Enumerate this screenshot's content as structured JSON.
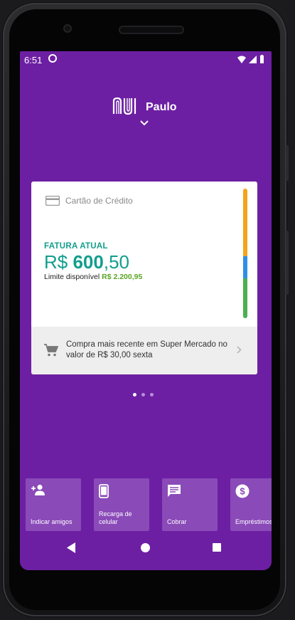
{
  "status_bar": {
    "time": "6:51"
  },
  "header": {
    "user_name": "Paulo"
  },
  "card": {
    "title": "Cartão de Crédito",
    "invoice_label": "FATURA ATUAL",
    "amount_currency": "R$ ",
    "amount_integer": "600",
    "amount_cents": ",50",
    "limit_label": "Limite disponível ",
    "limit_value": "R$ 2.200,95",
    "usage_bar": [
      {
        "color": "#f5a31a",
        "fraction": 0.52
      },
      {
        "color": "#2f8fe8",
        "fraction": 0.17
      },
      {
        "color": "#4caf50",
        "fraction": 0.31
      }
    ],
    "recent_purchase": "Compra mais recente em Super Mercado no valor de R$ 30,00 sexta"
  },
  "pager": {
    "count": 3,
    "active": 0
  },
  "shortcuts": [
    {
      "label": "Indicar amigos",
      "icon": "add-person-icon"
    },
    {
      "label": "Recarga de celular",
      "icon": "phone-icon"
    },
    {
      "label": "Cobrar",
      "icon": "chat-icon"
    },
    {
      "label": "Empréstimos",
      "icon": "dollar-icon"
    }
  ],
  "colors": {
    "background": "#6d1fa3",
    "tile": "#8a4ab8",
    "accent": "#129e8d",
    "limit": "#5aa524"
  }
}
